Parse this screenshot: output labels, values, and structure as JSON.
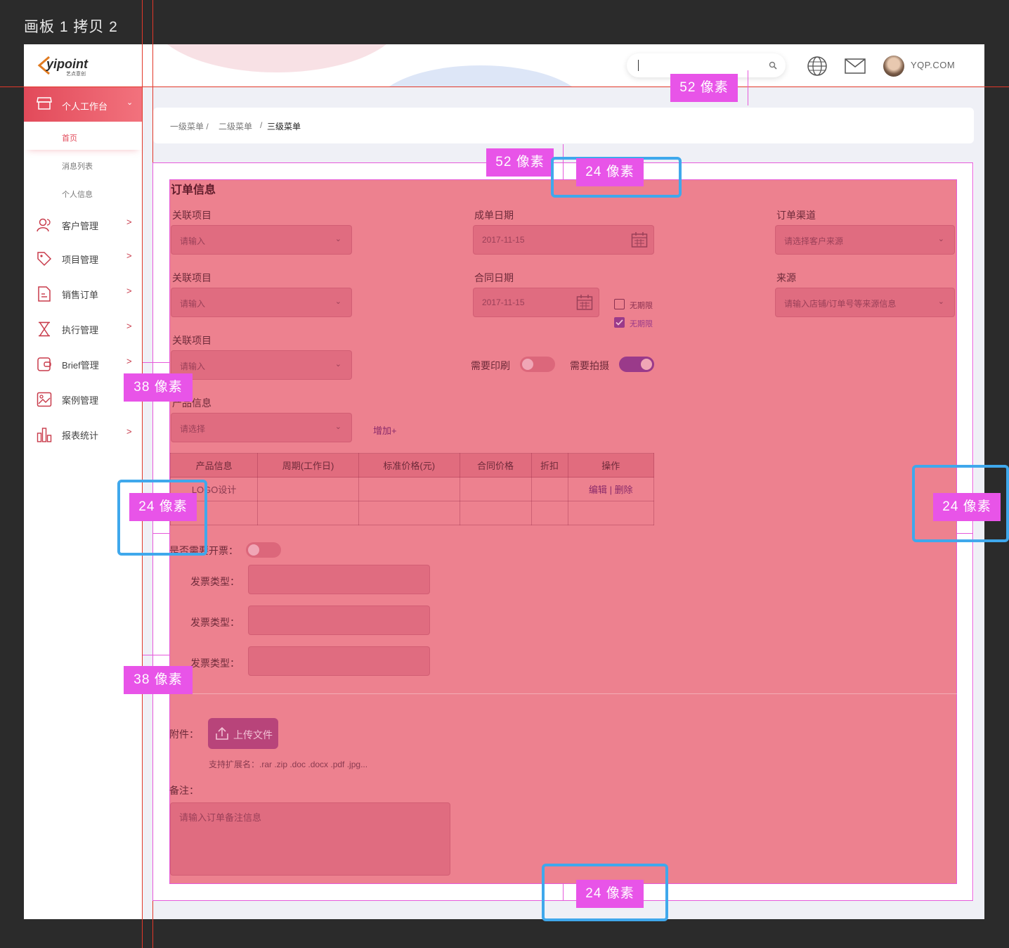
{
  "artboard": {
    "title": "画板 1 拷贝 2"
  },
  "header": {
    "logo_text": "yipoint",
    "logo_sub": "艺点意创",
    "user_label": "YQP.COM"
  },
  "sidebar": {
    "active": {
      "label": "个人工作台"
    },
    "subitems": [
      {
        "label": "首页"
      },
      {
        "label": "消息列表"
      },
      {
        "label": "个人信息"
      }
    ],
    "items": [
      {
        "label": "客户管理",
        "icon": "users-icon"
      },
      {
        "label": "项目管理",
        "icon": "tag-icon"
      },
      {
        "label": "销售订单",
        "icon": "document-icon"
      },
      {
        "label": "执行管理",
        "icon": "hourglass-icon"
      },
      {
        "label": "Brief管理",
        "icon": "wallet-icon"
      },
      {
        "label": "案例管理",
        "icon": "image-icon"
      },
      {
        "label": "报表统计",
        "icon": "bar-chart-icon"
      }
    ]
  },
  "breadcrumb": {
    "level1": "一级菜单 /",
    "level2": "二级菜单",
    "sep": "/",
    "level3": "三级菜单"
  },
  "form": {
    "title": "订单信息",
    "row1": {
      "related_label": "关联项目",
      "related_ph": "请输入",
      "deal_date_label": "成单日期",
      "deal_date_value": "2017-11-15",
      "channel_label": "订单渠道",
      "channel_ph": "请选择客户来源"
    },
    "row2": {
      "related_label": "关联项目",
      "related_ph": "请输入",
      "contract_date_label": "合同日期",
      "contract_date_value": "2017-11-15",
      "unlimited1": "无期限",
      "unlimited2": "无期限",
      "source_label": "来源",
      "source_ph": "请输入店铺/订单号等来源信息"
    },
    "row3": {
      "related_label": "关联项目",
      "related_ph": "请输入",
      "print_label": "需要印刷",
      "shoot_label": "需要拍摄"
    },
    "product": {
      "label": "产品信息",
      "ph": "请选择",
      "add": "增加+"
    },
    "table": {
      "headers": [
        "产品信息",
        "周期(工作日)",
        "标准价格(元)",
        "合同价格",
        "折扣",
        "操作"
      ],
      "rows": [
        [
          "LOGO设计",
          "",
          "",
          "",
          "",
          ""
        ]
      ],
      "edit": "编辑",
      "delete": "删除"
    },
    "invoice": {
      "need_label": "是否需要开票：",
      "type_labels": [
        "发票类型：",
        "发票类型：",
        "发票类型："
      ]
    },
    "attachment": {
      "label": "附件：",
      "button": "上传文件",
      "hint": "支持扩展名：.rar .zip .doc .docx .pdf .jpg..."
    },
    "remark": {
      "label": "备注：",
      "ph": "请输入订单备注信息"
    }
  },
  "annotations": {
    "top_52a": "52 像素",
    "top_52b": "52 像素",
    "top_24": "24 像素",
    "left_38a": "38 像素",
    "left_24": "24 像素",
    "right_24": "24 像素",
    "left_38b": "38 像素",
    "bottom_24": "24 像素"
  },
  "colors": {
    "accent": "#e24a5a",
    "annotation": "#e854e8",
    "highlight": "#3fa8ec"
  }
}
